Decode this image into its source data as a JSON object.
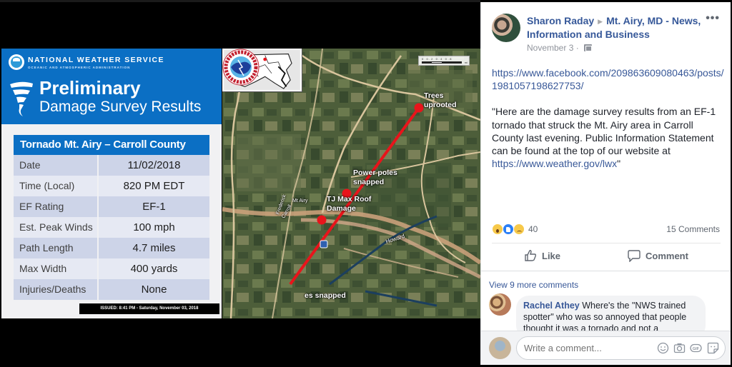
{
  "slide": {
    "org_name": "NATIONAL WEATHER SERVICE",
    "org_subtitle": "OCEANIC AND ATMOSPHERIC ADMINISTRATION",
    "title": "Preliminary",
    "subtitle": "Damage Survey Results",
    "table_title": "Tornado Mt. Airy – Carroll County",
    "rows": [
      {
        "label": "Date",
        "value": "11/02/2018"
      },
      {
        "label": "Time (Local)",
        "value": "820 PM EDT"
      },
      {
        "label": "EF Rating",
        "value": "EF-1"
      },
      {
        "label": "Est. Peak Winds",
        "value": "100 mph"
      },
      {
        "label": "Path Length",
        "value": "4.7 miles"
      },
      {
        "label": "Max Width",
        "value": "400 yards"
      },
      {
        "label": "Injuries/Deaths",
        "value": "None"
      }
    ],
    "issued": "ISSUED: 8:41 PM - Saturday, November 03, 2018",
    "header_color": "#0b6fc4"
  },
  "map": {
    "labels": {
      "trees": "Trees\nuprooted",
      "power_poles": "Power poles\nsnapped",
      "tj_max": "TJ Max Roof\nDamage",
      "snapped_bottom": "es snapped",
      "howard": "Howard",
      "mt_airy": "Mt Airy",
      "frederick": "Frederick",
      "carroll": "Carroll"
    },
    "scale_ticks": "0  0.2  0.4        0.8",
    "scale_unit": "mi",
    "track_color": "#e8141b"
  },
  "post": {
    "author": "Sharon Raday",
    "group": "Mt. Airy, MD - News, Information and Business",
    "date": "November 3",
    "date_separator": "·",
    "options_label": "•••",
    "link": "https://www.facebook.com/209863609080463/posts/1981057198627753/",
    "link_line1": "https://www.facebook.com/209863609080463/posts/",
    "link_line2": "1981057198627753/",
    "body": "\"Here are the damage survey results from an EF-1 tornado that struck the Mt. Airy area in Carroll County last evening. Public Information Statement can be found at the top of our website at ",
    "body_link": "https://www.weather.gov/lwx",
    "body_end": "\"",
    "reactions": [
      "wow",
      "like",
      "sad"
    ],
    "reaction_count": "40",
    "comment_count": "15 Comments",
    "like_label": "Like",
    "comment_label": "Comment",
    "view_more": "View 9 more comments",
    "comment": {
      "author": "Rachel Athey",
      "text": " Where's the \"NWS trained spotter\" who was so annoyed that people thought it was a tornado and not a"
    },
    "composer_placeholder": "Write a comment...",
    "link_color": "#385898"
  }
}
